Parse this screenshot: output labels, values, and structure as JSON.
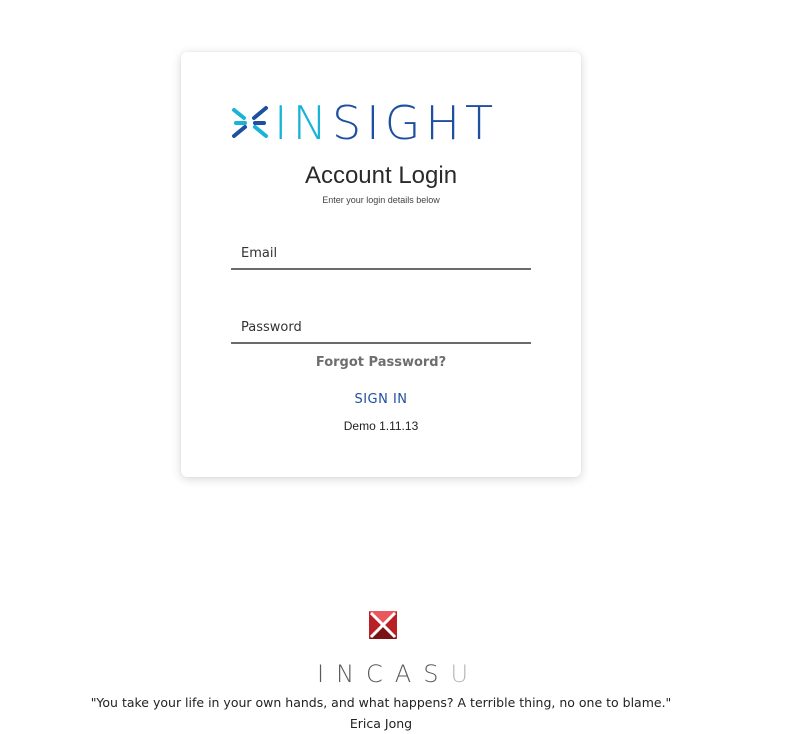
{
  "brand": {
    "logo_icon": "insight-cross-arrows-icon",
    "logo_text_accent": "IN",
    "logo_text_main": "SIGHT",
    "colors": {
      "accent": "#1ab3d6",
      "primary": "#1e4fa0"
    }
  },
  "login": {
    "title": "Account Login",
    "subtitle": "Enter your login details below",
    "email_placeholder": "Email",
    "password_placeholder": "Password",
    "forgot_label": "Forgot Password?",
    "signin_label": "SIGN IN",
    "version": "Demo 1.11.13"
  },
  "footer": {
    "logo_icon": "incasu-hourglass-icon",
    "brand_main": "INCAS",
    "brand_tail": "U",
    "quote": "\"You take your life in your own hands, and what happens? A terrible thing, no one to blame.\"",
    "author": "Erica Jong"
  }
}
